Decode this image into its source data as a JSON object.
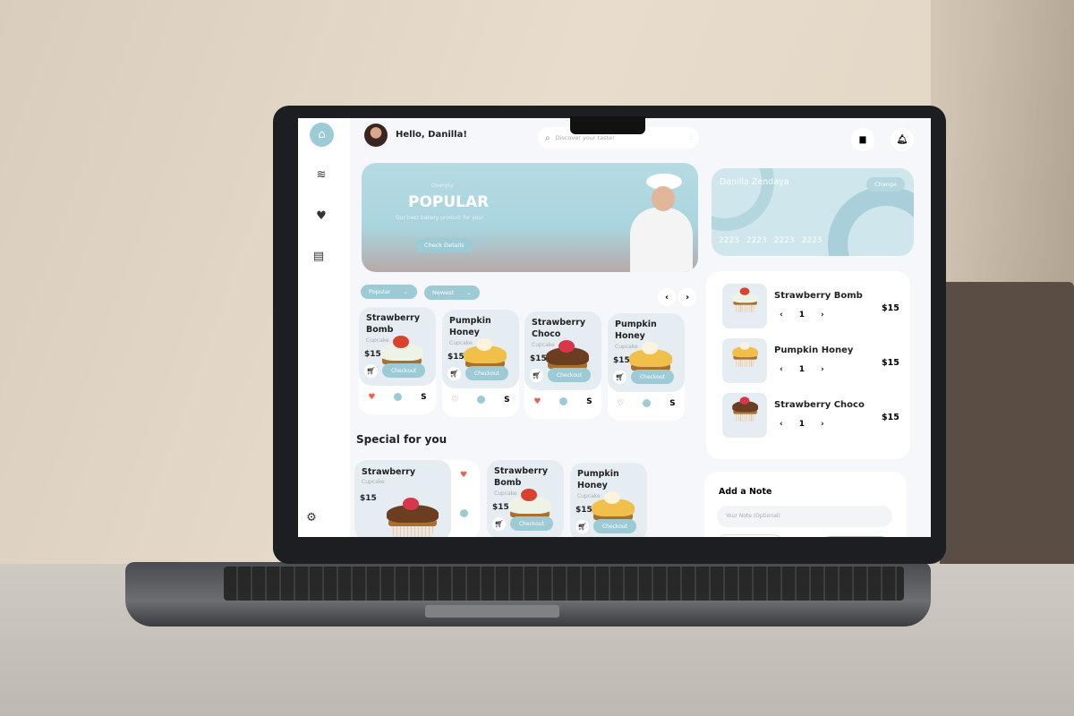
{
  "header": {
    "greeting": "Hello, Danilla!",
    "search_placeholder": "Discover your taste!"
  },
  "sidebar": {
    "items": [
      {
        "icon": "home-icon"
      },
      {
        "icon": "wave-icon"
      },
      {
        "icon": "heart-icon"
      },
      {
        "icon": "receipt-icon"
      }
    ],
    "settings_icon": "gear-icon"
  },
  "banner": {
    "brand": "OvenJoy",
    "title": "POPULAR",
    "subtitle": "Our best bakery product for you!",
    "button": "Check Details"
  },
  "filters": [
    {
      "label": "Popular"
    },
    {
      "label": "Newest"
    }
  ],
  "nav": {
    "prev": "‹",
    "next": "›"
  },
  "products": [
    {
      "name": "Strawberry Bomb",
      "sub": "Cupcake",
      "price": "$15",
      "checkout": "Checkout",
      "size": "S",
      "liked": true,
      "frost": "#eef3e6",
      "top": "#d8432e"
    },
    {
      "name": "Pumpkin Honey",
      "sub": "Cupcake",
      "price": "$15",
      "checkout": "Checkout",
      "size": "S",
      "liked": false,
      "frost": "#f0c04a",
      "top": "#fbf3dd"
    },
    {
      "name": "Strawberry Choco",
      "sub": "Cupcake",
      "price": "$15",
      "checkout": "Checkout",
      "size": "S",
      "liked": true,
      "frost": "#6b3e22",
      "top": "#d8374a"
    },
    {
      "name": "Pumpkin Honey",
      "sub": "Cupcake",
      "price": "$15",
      "checkout": "Checkout",
      "size": "S",
      "liked": false,
      "frost": "#f0c04a",
      "top": "#fbf3dd"
    }
  ],
  "special": {
    "title": "Special for you",
    "items": [
      {
        "name": "Strawberry",
        "sub": "Cupcake",
        "price": "$15"
      },
      {
        "name": "Strawberry Bomb",
        "sub": "Cupcake",
        "price": "$15",
        "checkout": "Checkout"
      },
      {
        "name": "Pumpkin Honey",
        "sub": "Cupcake",
        "price": "$15",
        "checkout": "Checkout"
      }
    ]
  },
  "payment_card": {
    "holder": "Danilla Zendaya",
    "change": "Change",
    "number": [
      "2223",
      "2223",
      "2223",
      "2223"
    ]
  },
  "cart": [
    {
      "name": "Strawberry Bomb",
      "qty": "1",
      "price": "$15"
    },
    {
      "name": "Pumpkin Honey",
      "qty": "1",
      "price": "$15"
    },
    {
      "name": "Strawberry Choco",
      "qty": "1",
      "price": "$15"
    }
  ],
  "note": {
    "title": "Add a Note",
    "placeholder": "Your Note (Optional)"
  },
  "colors": {
    "accent": "#9ccbd6",
    "like": "#e8624f",
    "background": "#f6f7fa"
  }
}
